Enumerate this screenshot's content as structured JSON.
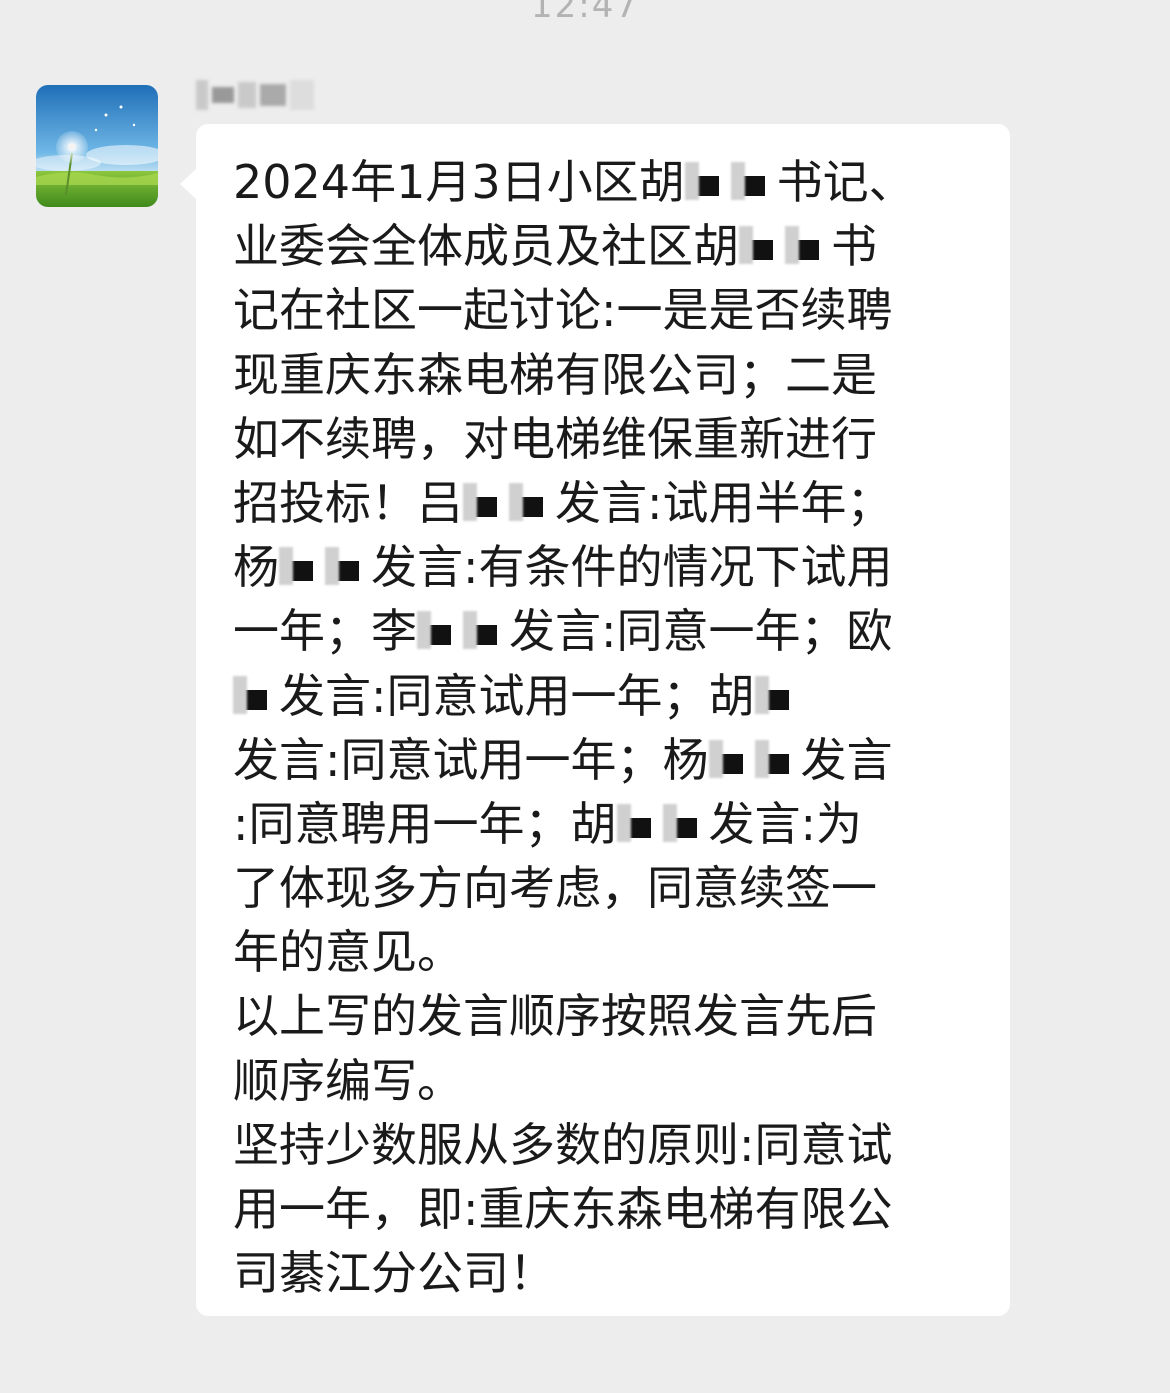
{
  "timestamp": "12:47",
  "sender": {
    "avatar_icon": "dandelion-landscape-avatar"
  },
  "message": {
    "lines": [
      [
        "2024年1月3日小区胡",
        "",
        "书记、"
      ],
      [
        "业委会全体成员及社区胡",
        "",
        "书"
      ],
      [
        "记在社区一起讨论:一是是否续聘"
      ],
      [
        "现重庆东森电梯有限公司；二是"
      ],
      [
        "如不续聘，对电梯维保重新进行"
      ],
      [
        "招投标！吕",
        "",
        "发言:试用半年；"
      ],
      [
        "杨",
        "",
        "发言:有条件的情况下试用"
      ],
      [
        "一年；李",
        "",
        "发言:同意一年；欧"
      ],
      [
        "",
        "发言:同意试用一年；胡",
        ""
      ],
      [
        "发言:同意试用一年；杨",
        "",
        "发言"
      ],
      [
        ":同意聘用一年；胡",
        "",
        "发言:为"
      ],
      [
        "了体现多方向考虑，同意续签一"
      ],
      [
        "年的意见。"
      ],
      [
        "以上写的发言顺序按照发言先后"
      ],
      [
        "顺序编写。"
      ],
      [
        "坚持少数服从多数的原则:同意试"
      ],
      [
        "用一年，即:重庆东森电梯有限公"
      ],
      [
        "司綦江分公司！"
      ]
    ]
  }
}
